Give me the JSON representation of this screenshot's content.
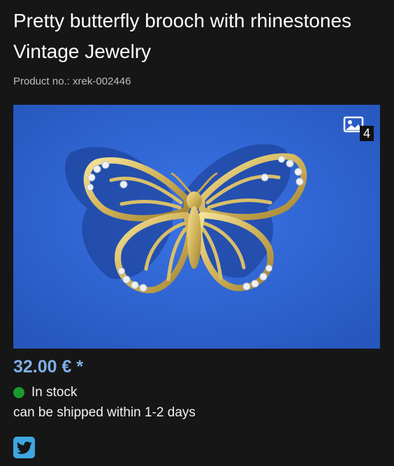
{
  "product": {
    "title": "Pretty butterfly brooch with rhinestones Vintage Jewelry",
    "product_no": "Product no.: xrek-002446",
    "image": {
      "description_icon": "butterfly-brooch-photo",
      "gallery_icon": "image-gallery-icon",
      "gallery_count": "4"
    },
    "price": "32.00 € *",
    "stock_status": "In stock",
    "shipping_info": "can be shipped within 1-2 days",
    "colors": {
      "background": "#161616",
      "price": "#7fb0e8",
      "stock_dot": "#1a9a2e",
      "image_background": "#2f66d6",
      "twitter": "#3fa7e0"
    }
  },
  "share": {
    "twitter_icon": "twitter-icon"
  }
}
